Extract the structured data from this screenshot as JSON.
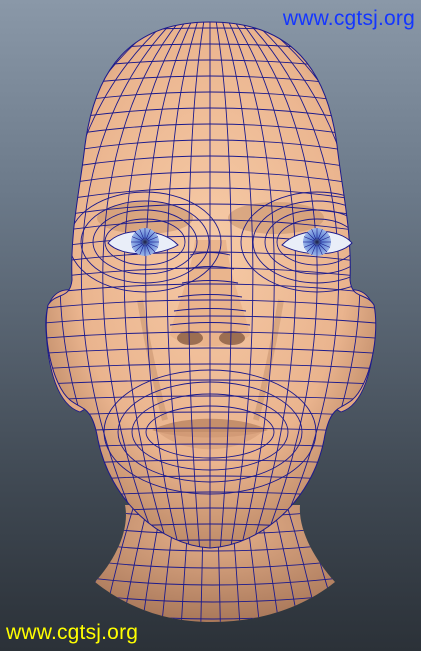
{
  "viewport": {
    "background_top": "#8a98a8",
    "background_bottom": "#2b3138"
  },
  "model": {
    "skin_color": "#f2bf99",
    "skin_shadow": "#b98664",
    "wire_color": "#1c1a8c",
    "eye_white": "#e9eef8",
    "iris_color": "#6a8fd6"
  },
  "watermarks": {
    "top": "www.cgtsj.org",
    "top_color": "#1436ff",
    "bottom": "www.cgtsj.org",
    "bottom_color": "#ffff00"
  }
}
